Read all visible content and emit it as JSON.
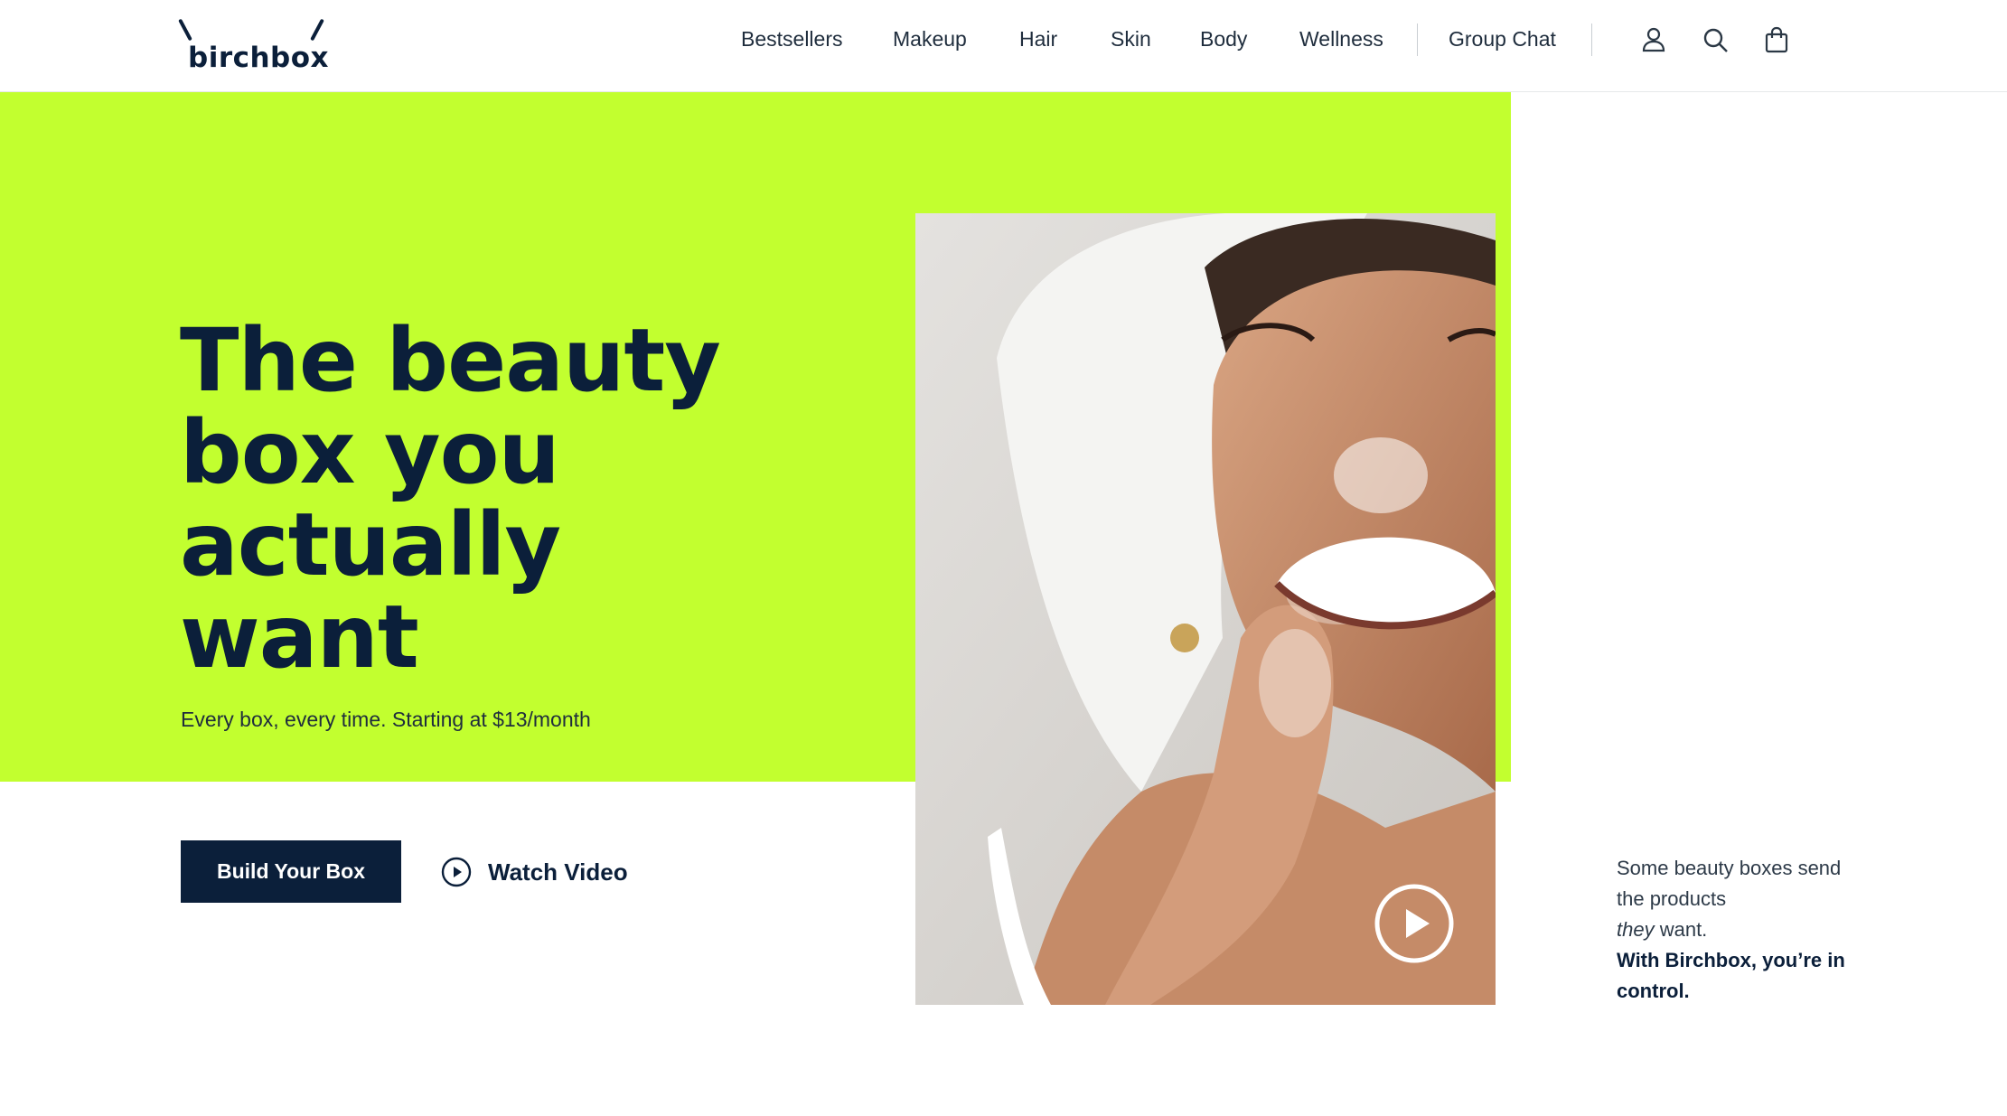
{
  "brand": {
    "logo_text": "birchbox"
  },
  "nav": {
    "items": [
      {
        "label": "Bestsellers"
      },
      {
        "label": "Makeup"
      },
      {
        "label": "Hair"
      },
      {
        "label": "Skin"
      },
      {
        "label": "Body"
      },
      {
        "label": "Wellness"
      },
      {
        "label": "Group Chat"
      }
    ],
    "icons": [
      "account-icon",
      "search-icon",
      "shopping-bag-icon"
    ]
  },
  "hero": {
    "headline": "The beauty box you actually want",
    "subhead": "Every box, every time. Starting at $13/month",
    "cta_label": "Build Your Box",
    "video_label": "Watch Video",
    "background_color": "#c2ff2f"
  },
  "side_copy": {
    "line1": "Some beauty boxes send the products",
    "emph": "they",
    "line2": " want.",
    "bold": "With Birchbox, you’re in control."
  },
  "colors": {
    "navy": "#0b1f3a",
    "lime": "#c2ff2f"
  }
}
